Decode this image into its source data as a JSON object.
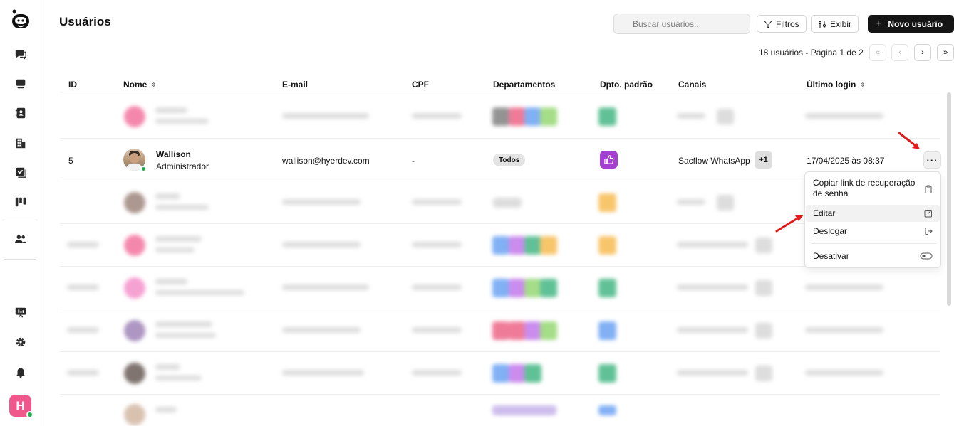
{
  "page": {
    "title": "Usuários",
    "search_placeholder": "Buscar usuários...",
    "filters_label": "Filtros",
    "display_label": "Exibir",
    "new_user_label": "Novo usuário",
    "pagination_text": "18 usuários - Página 1 de 2"
  },
  "sidebar": {
    "icons": [
      "chat-icon",
      "inbox-icon",
      "contacts-icon",
      "building-icon",
      "tasks-icon",
      "kanban-icon",
      "team-icon",
      "dashboard-icon",
      "settings-icon",
      "bell-icon"
    ],
    "user_initial": "H"
  },
  "table": {
    "headers": {
      "id": "ID",
      "name": "Nome",
      "email": "E-mail",
      "cpf": "CPF",
      "departments": "Departamentos",
      "default_dept": "Dpto. padrão",
      "channels": "Canais",
      "last_login": "Último login"
    },
    "focus_row": {
      "id": "5",
      "name": "Wallison",
      "role": "Administrador",
      "email": "wallison@hyerdev.com",
      "cpf": "-",
      "department": "Todos",
      "channel": "Sacflow WhatsApp",
      "channel_extra": "+1",
      "last_login": "17/04/2025 às 08:37"
    }
  },
  "row_menu": {
    "items": [
      {
        "label": "Copiar link de recuperação de senha",
        "icon": "clipboard-icon"
      },
      {
        "label": "Editar",
        "icon": "edit-icon"
      },
      {
        "label": "Deslogar",
        "icon": "logout-icon"
      },
      {
        "label": "Desativar",
        "icon": "toggle-icon"
      }
    ]
  },
  "colors": {
    "primary_button": "#151515",
    "dept_badge": "#a53fd3",
    "online": "#22b24c",
    "avatar": "#f0578a",
    "arrow": "#e01b1b"
  }
}
